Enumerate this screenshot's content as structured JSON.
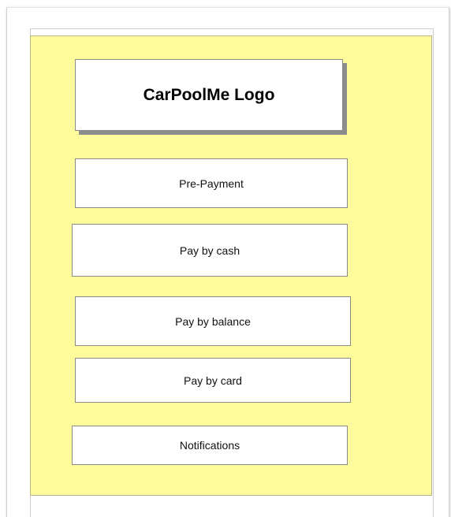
{
  "logo": {
    "text": "CarPoolMe Logo"
  },
  "menu": {
    "items": [
      {
        "label": "Pre-Payment"
      },
      {
        "label": "Pay by cash"
      },
      {
        "label": "Pay by balance"
      },
      {
        "label": "Pay by card"
      },
      {
        "label": "Notifications"
      }
    ]
  },
  "colors": {
    "panel_background": "#fdfb9b",
    "button_background": "#ffffff",
    "border": "#8a8a8a"
  }
}
